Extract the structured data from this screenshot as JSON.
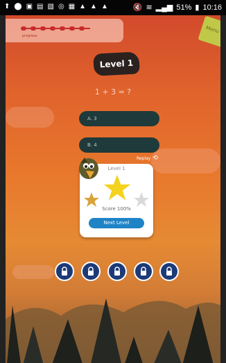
{
  "status_bar": {
    "battery": "51%",
    "time": "10:16"
  },
  "progress": {
    "label": "progress"
  },
  "menu_label": "Menu",
  "level_badge": "Level 1",
  "question": "1 + 3 = ?",
  "answers": [
    {
      "label": "A. 3"
    },
    {
      "label": "B. 4"
    }
  ],
  "popup": {
    "title": "Level 1",
    "replay_label": "Replay",
    "score_text": "Score 100%",
    "next_button": "Next Level",
    "stars_earned": 1,
    "stars_total": 3
  },
  "locks_count": 5,
  "colors": {
    "button_blue": "#1f84c6",
    "lock_blue": "#1d3a78",
    "answer_bg": "#1f3a3a"
  }
}
